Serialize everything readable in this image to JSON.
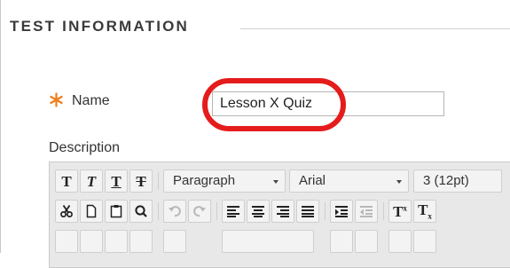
{
  "section": {
    "title": "TEST INFORMATION"
  },
  "name_field": {
    "label": "Name",
    "value": "Lesson X Quiz",
    "required_icon": "asterisk-icon",
    "required_color": "#f07d19"
  },
  "description_field": {
    "label": "Description",
    "editor": {
      "row1": {
        "format_buttons": [
          "bold-icon",
          "italic-icon",
          "underline-icon",
          "strikethrough-icon"
        ],
        "block_format": "Paragraph",
        "font_family": "Arial",
        "font_size": "3 (12pt)"
      },
      "row2": {
        "buttons": [
          "cut-icon",
          "copy-icon",
          "paste-icon",
          "find-icon",
          "undo-icon",
          "redo-icon",
          "align-left-icon",
          "align-center-icon",
          "align-right-icon",
          "align-justify-icon",
          "indent-icon",
          "outdent-icon",
          "superscript-icon",
          "subscript-icon"
        ]
      }
    }
  },
  "highlight_color": "#e51c1c"
}
